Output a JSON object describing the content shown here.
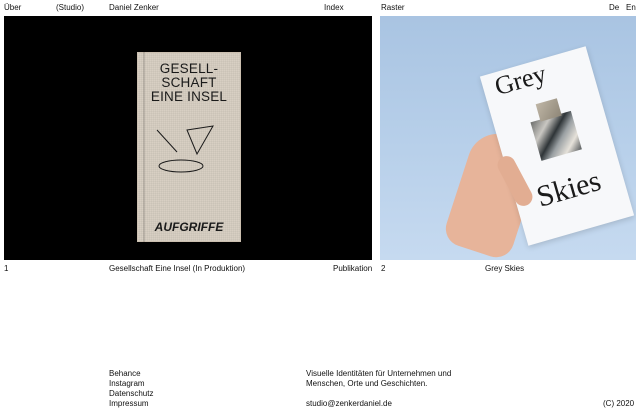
{
  "header": {
    "about": "Über",
    "studio": "(Studio)",
    "name": "Daniel Zenker",
    "index": "Index",
    "raster": "Raster",
    "lang_de": "De",
    "lang_en": "En"
  },
  "projects": [
    {
      "number": "1",
      "title": "Gesellschaft Eine Insel (In Produktion)",
      "category": "Publikation",
      "image": {
        "book_title": "GESELL-\nSCHAFT\nEINE INSEL",
        "book_series": "AUFGRIFFE"
      }
    },
    {
      "number": "2",
      "title": "Grey Skies",
      "image": {
        "card_line_1": "Grey",
        "card_line_2": "Skies"
      }
    }
  ],
  "footer": {
    "links": [
      "Behance",
      "Instagram",
      "Datenschutz",
      "Impressum"
    ],
    "tagline_1": "Visuelle Identitäten für Unternehmen und",
    "tagline_2": "Menschen, Orte und Geschichten.",
    "email": "studio@zenkerdaniel.de",
    "copyright": "(C) 2020"
  }
}
